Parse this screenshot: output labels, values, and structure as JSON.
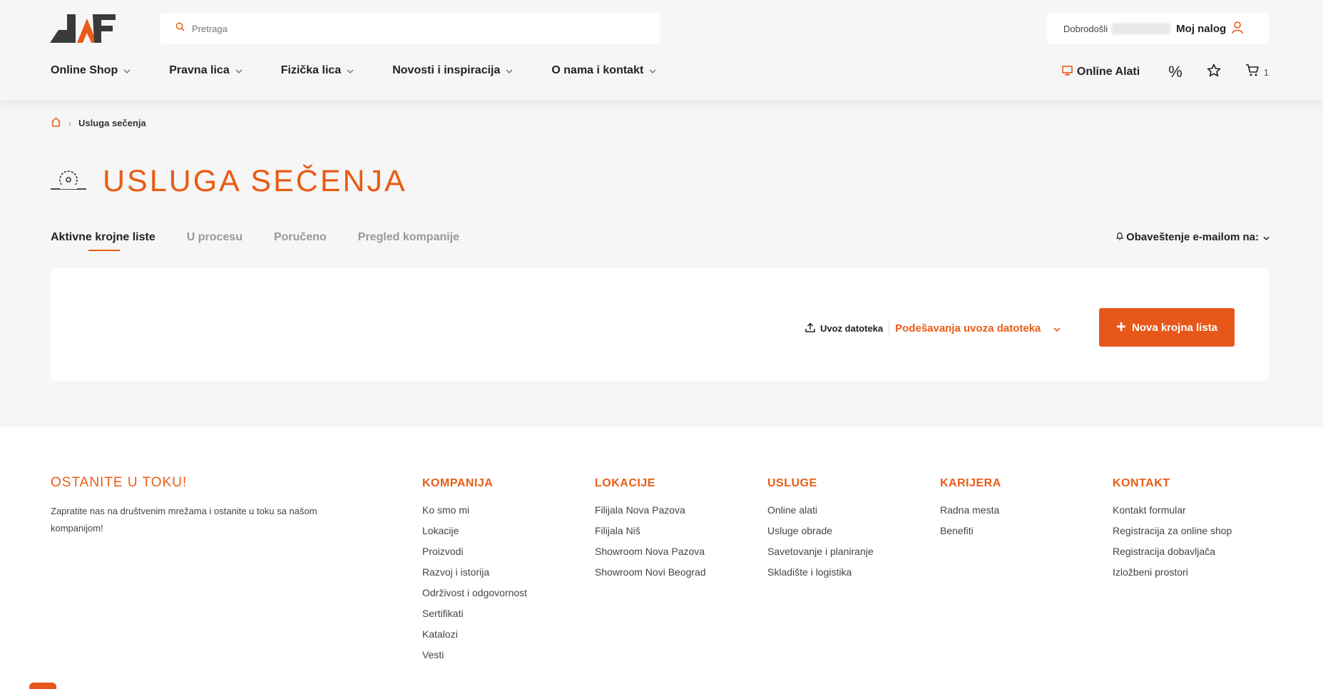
{
  "header": {
    "search_placeholder": "Pretraga",
    "welcome": "Dobrodošli",
    "account_label": "Moj nalog",
    "nav": [
      {
        "label": "Online Shop"
      },
      {
        "label": "Pravna lica"
      },
      {
        "label": "Fizička lica"
      },
      {
        "label": "Novosti i inspiracija"
      },
      {
        "label": "O nama i kontakt"
      }
    ],
    "online_tools": "Online Alati",
    "discount_symbol": "%",
    "cart_count": "1"
  },
  "breadcrumb": {
    "current": "Usluga sečenja"
  },
  "title": "USLUGA SEČENJA",
  "tabs": [
    {
      "label": "Aktivne krojne liste",
      "active": true
    },
    {
      "label": "U procesu",
      "active": false
    },
    {
      "label": "Poručeno",
      "active": false
    },
    {
      "label": "Pregled kompanije",
      "active": false
    }
  ],
  "notify_label": "Obaveštenje e-mailom na:",
  "card": {
    "import_label": "Uvoz datoteka",
    "import_settings": "Podešavanja uvoza datoteka",
    "new_button": "Nova krojna lista"
  },
  "footer": {
    "stay_title": "OSTANITE U TOKU!",
    "stay_text": "Zapratite nas na društvenim mrežama i ostanite u toku sa našom kompanijom!",
    "columns": [
      {
        "title": "KOMPANIJA",
        "links": [
          "Ko smo mi",
          "Lokacije",
          "Proizvodi",
          "Razvoj i istorija",
          "Održivost i odgovornost",
          "Sertifikati",
          "Katalozi",
          "Vesti"
        ]
      },
      {
        "title": "LOKACIJE",
        "links": [
          "Filijala Nova Pazova",
          "Filijala Niš",
          "Showroom Nova Pazova",
          "Showroom Novi Beograd"
        ]
      },
      {
        "title": "USLUGE",
        "links": [
          "Online alati",
          "Usluge obrade",
          "Savetovanje i planiranje",
          "Skladište i logistika"
        ]
      },
      {
        "title": "KARIJERA",
        "links": [
          "Radna mesta",
          "Benefiti"
        ]
      },
      {
        "title": "KONTAKT",
        "links": [
          "Kontakt formular",
          "Registracija za online shop",
          "Registracija dobavljača",
          "Izložbeni prostori"
        ]
      }
    ]
  },
  "colors": {
    "accent": "#ea5b15",
    "background": "#f6f6f6"
  }
}
